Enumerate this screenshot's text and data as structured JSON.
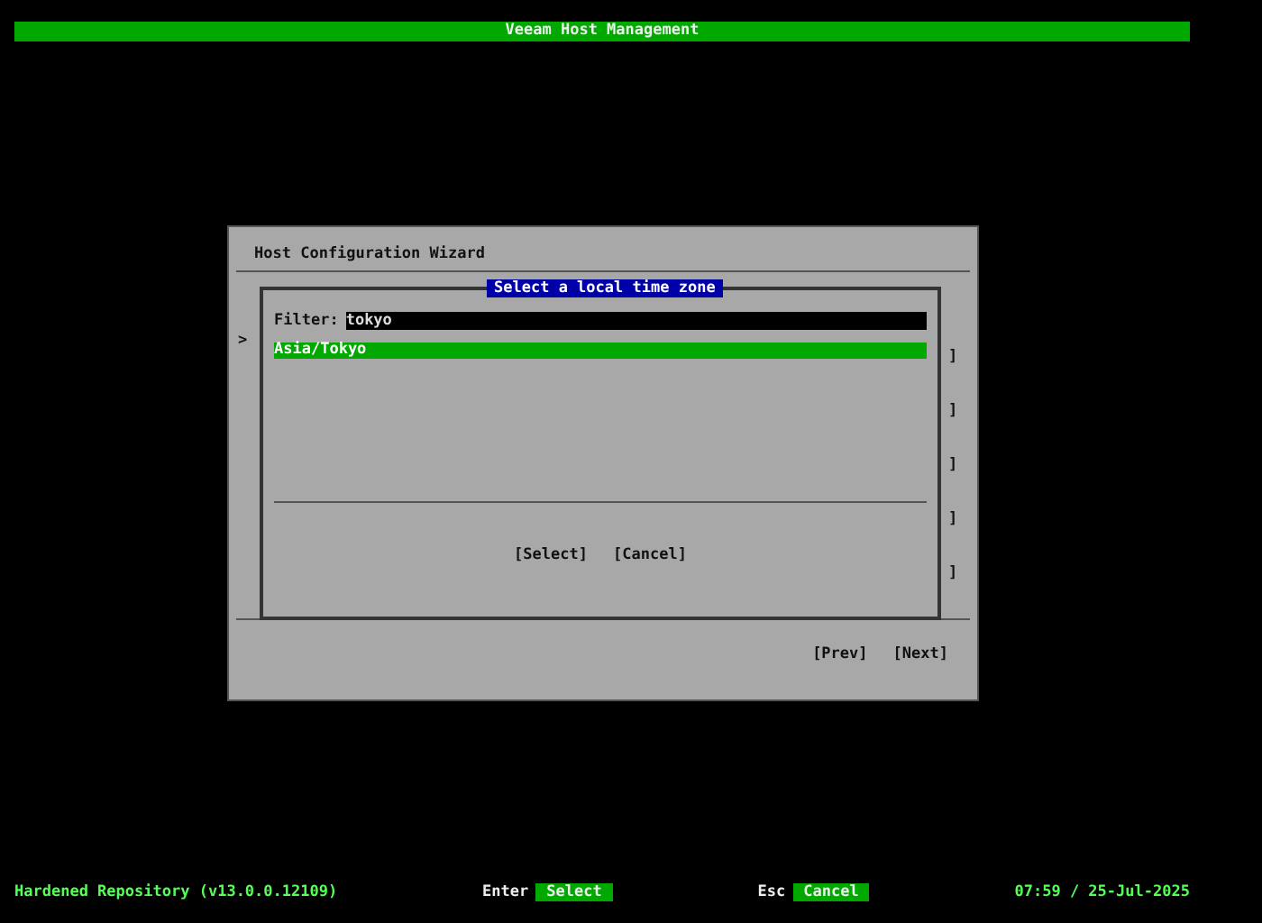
{
  "header": {
    "title": "Veeam Host Management"
  },
  "wizard": {
    "title": "Host Configuration Wizard",
    "cursor": ">",
    "side_marks": [
      "]",
      "]",
      "]",
      "]",
      "]"
    ],
    "buttons": [
      "[Prev]",
      "[Next]"
    ]
  },
  "timezone_dialog": {
    "title": "Select a local time zone",
    "filter": {
      "label": "Filter:",
      "value": "tokyo"
    },
    "items": [
      {
        "label": "Asia/Tokyo",
        "selected": true
      }
    ],
    "buttons": [
      "[Select]",
      "[Cancel]"
    ]
  },
  "status_bar": {
    "product": "Hardened Repository (v13.0.0.12109)",
    "hints": [
      {
        "key": "Enter",
        "label": "Select"
      },
      {
        "key": "Esc",
        "label": "Cancel"
      }
    ],
    "datetime": "07:59 / 25-Jul-2025"
  }
}
